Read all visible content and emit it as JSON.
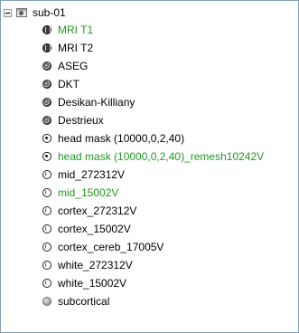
{
  "tree": {
    "root": {
      "label": "sub-01",
      "icon": "subject-icon"
    },
    "items": [
      {
        "label": "MRI T1",
        "icon": "mri-icon",
        "selected": true
      },
      {
        "label": "MRI T2",
        "icon": "mri-icon",
        "selected": false
      },
      {
        "label": "ASEG",
        "icon": "atlas-icon",
        "selected": false
      },
      {
        "label": "DKT",
        "icon": "atlas-icon",
        "selected": false
      },
      {
        "label": "Desikan-Killiany",
        "icon": "atlas-icon",
        "selected": false
      },
      {
        "label": "Destrieux",
        "icon": "atlas-icon",
        "selected": false
      },
      {
        "label": "head mask (10000,0,2,40)",
        "icon": "head-surface-icon",
        "selected": false
      },
      {
        "label": "head mask (10000,0,2,40)_remesh10242V",
        "icon": "head-surface-icon",
        "selected": true
      },
      {
        "label": "mid_272312V",
        "icon": "cortex-surface-icon",
        "selected": false
      },
      {
        "label": "mid_15002V",
        "icon": "cortex-surface-icon",
        "selected": true
      },
      {
        "label": "cortex_272312V",
        "icon": "cortex-surface-icon",
        "selected": false
      },
      {
        "label": "cortex_15002V",
        "icon": "cortex-surface-icon",
        "selected": false
      },
      {
        "label": "cortex_cereb_17005V",
        "icon": "cortex-surface-icon",
        "selected": false
      },
      {
        "label": "white_272312V",
        "icon": "cortex-surface-icon",
        "selected": false
      },
      {
        "label": "white_15002V",
        "icon": "cortex-surface-icon",
        "selected": false
      },
      {
        "label": "subcortical",
        "icon": "subcortical-icon",
        "selected": false
      }
    ]
  },
  "colors": {
    "selected_text": "#1e9a1e",
    "border": "#7f9db9"
  }
}
